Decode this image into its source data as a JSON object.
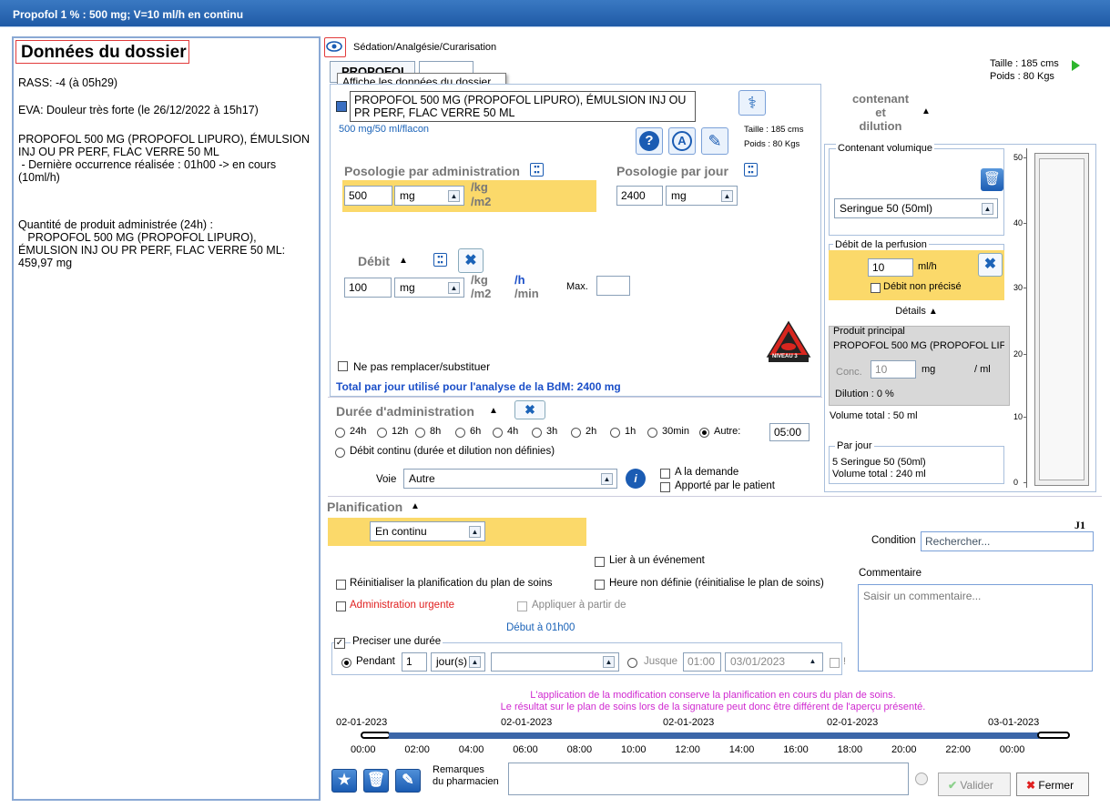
{
  "window": {
    "title": "Propofol 1 % : 500 mg; V=10 ml/h  en continu"
  },
  "left_panel": {
    "title": "Données du dossier",
    "rass": "RASS: -4 (à 05h29)",
    "eva": "EVA: Douleur très forte (le 26/12/2022 à 15h17)",
    "product_block": "PROPOFOL 500 MG (PROPOFOL LIPURO), ÉMULSION\nINJ OU PR PERF, FLAC VERRE 50 ML\n - Dernière occurrence réalisée : 01h00 -> en cours\n(10ml/h)",
    "quantity_block": "Quantité de produit administrée (24h) :\n   PROPOFOL 500 MG (PROPOFOL LIPURO),\nÉMULSION INJ OU PR PERF, FLAC VERRE 50 ML:\n459,97 mg"
  },
  "header": {
    "section_label": "Sédation/Analgésie/Curarisation",
    "tab1": "PROPOFOL *",
    "tooltip": "Affiche les données du dossier",
    "taille": "Taille : 185 cms",
    "poids": "Poids : 80 Kgs"
  },
  "product": {
    "name": "PROPOFOL 500 MG (PROPOFOL LIPURO), ÉMULSION INJ OU PR PERF, FLAC VERRE 50 ML",
    "concentration": "500 mg/50 ml/flacon",
    "taille": "Taille : 185 cms",
    "poids": "Poids : 80 Kgs",
    "level_badge": "NIVEAU 3"
  },
  "posologie": {
    "admin_label": "Posologie par administration",
    "admin_value": "500",
    "admin_unit": "mg",
    "per_kg": "/kg",
    "per_m2": "/m2",
    "jour_label": "Posologie par jour",
    "jour_value": "2400",
    "jour_unit": "mg"
  },
  "debit": {
    "label": "Débit",
    "value": "100",
    "unit": "mg",
    "per_kg": "/kg",
    "per_m2": "/m2",
    "per_h": "/h",
    "per_min": "/min",
    "max_label": "Max.",
    "max_value": ""
  },
  "substitution": {
    "label": "Ne pas remplacer/substituer"
  },
  "total_jour": "Total par jour utilisé pour l'analyse de la BdM: 2400 mg",
  "duree": {
    "label": "Durée d'administration",
    "options": [
      "24h",
      "12h",
      "8h",
      "6h",
      "4h",
      "3h",
      "2h",
      "1h",
      "30min",
      "Autre:"
    ],
    "autre_value": "05:00",
    "continu_label": "Débit continu (durée et dilution non définies)",
    "voie_label": "Voie",
    "voie_value": "Autre",
    "a_la_demande": "A la demande",
    "apporte_patient": "Apporté par le patient"
  },
  "contenant": {
    "header_line1": "contenant",
    "header_line2": "et",
    "header_line3": "dilution",
    "group_label": "Contenant volumique",
    "select_value": "Seringue 50 (50ml)",
    "debit_group_label": "Débit de la perfusion",
    "debit_value": "10",
    "debit_unit": "ml/h",
    "non_precise": "Débit non précisé",
    "details_label": "Détails",
    "produit_principal": "Produit principal",
    "produit_name": "PROPOFOL 500 MG (PROPOFOL LIF",
    "conc_label": "Conc.",
    "conc_value": "10",
    "conc_unit": "mg",
    "per_ml": "/ ml",
    "dilution": "Dilution : 0 %",
    "volume_total": "Volume total : 50 ml",
    "par_jour_label": "Par jour",
    "par_jour_line1": "5 Seringue 50 (50ml)",
    "par_jour_line2": "Volume total : 240 ml",
    "gauge_ticks": [
      "50",
      "40",
      "30",
      "20",
      "10",
      "0"
    ]
  },
  "planif": {
    "label": "Planification",
    "mode": "En continu",
    "j1": "J1",
    "condition_label": "Condition",
    "condition_placeholder": "Rechercher...",
    "lier_evenement": "Lier à un événement",
    "reinit_label": "Réinitialiser la planification du plan de soins",
    "heure_non_definie": "Heure non définie (réinitialise le plan de soins)",
    "urgente": "Administration urgente",
    "appliquer": "Appliquer à partir de",
    "debut": "Début à 01h00",
    "commentaire_label": "Commentaire",
    "commentaire_placeholder": "Saisir un commentaire...",
    "preciser_duree": "Preciser une durée",
    "pendant_label": "Pendant",
    "pendant_value": "1",
    "pendant_unit": "jour(s)",
    "jusque_label": "Jusque",
    "jusque_time": "01:00",
    "jusque_date": "03/01/2023",
    "bang": "!"
  },
  "notice": {
    "line1": "L'application de la modification conserve la planification en cours du plan de soins.",
    "line2": "Le résultat sur le plan de soins lors de la signature peut donc être différent de l'aperçu présenté."
  },
  "timeline": {
    "dates": [
      "02-01-2023",
      "02-01-2023",
      "02-01-2023",
      "02-01-2023",
      "03-01-2023"
    ],
    "hours": [
      "00:00",
      "02:00",
      "04:00",
      "06:00",
      "08:00",
      "10:00",
      "12:00",
      "14:00",
      "16:00",
      "18:00",
      "20:00",
      "22:00",
      "00:00"
    ]
  },
  "footer": {
    "remarques_line1": "Remarques",
    "remarques_line2": "du pharmacien",
    "valider": "Valider",
    "fermer": "Fermer"
  },
  "colors": {
    "title_bar": "#2a68b4",
    "highlight": "#fbd96a",
    "accent": "#1b5cb3",
    "urgent": "#e02020",
    "notice": "#d02ad0"
  }
}
